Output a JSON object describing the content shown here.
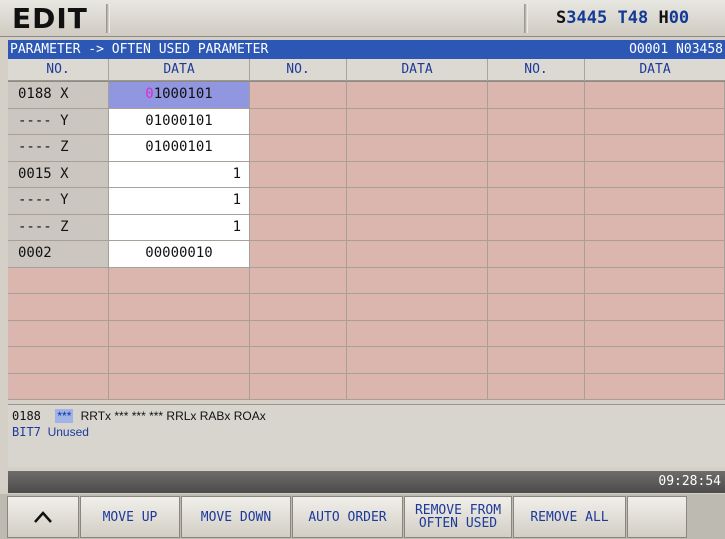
{
  "top": {
    "mode": "EDIT",
    "s_label": "S",
    "s_value": "3445",
    "t_label": "T",
    "t_value": "48",
    "h_label": "H",
    "h_value": "00"
  },
  "title": {
    "path": "PARAMETER -> OFTEN USED PARAMETER",
    "program": "O0001 N03458"
  },
  "table": {
    "headers": [
      "NO.",
      "DATA",
      "NO.",
      "DATA",
      "NO.",
      "DATA"
    ],
    "rows": [
      {
        "no": "0188 X",
        "data_cursor": "0",
        "data": "1000101"
      },
      {
        "no": "---- Y",
        "data": "01000101"
      },
      {
        "no": "---- Z",
        "data": "01000101"
      },
      {
        "no": "0015 X",
        "data": "1"
      },
      {
        "no": "---- Y",
        "data": "1"
      },
      {
        "no": "---- Z",
        "data": "1"
      },
      {
        "no": "0002",
        "data": "00000010"
      }
    ],
    "empty_rows": 5
  },
  "info": {
    "param": "0188",
    "bit_selected": "***",
    "bits": "RRTx *** *** *** RRLx RABx ROAx",
    "bit_label": "BIT7",
    "bit_desc": "Unused"
  },
  "status": {
    "time": "09:28:54"
  },
  "softkeys": {
    "back_icon": "caret-up-icon",
    "move_up": "MOVE UP",
    "move_down": "MOVE DOWN",
    "auto_order": "AUTO ORDER",
    "remove_from_line1": "REMOVE FROM",
    "remove_from_line2": "OFTEN USED",
    "remove_all": "REMOVE ALL"
  },
  "colors": {
    "title_bar": "#2c57b4",
    "status_text": "#123a96",
    "empty_cell": "#dbb6ae",
    "selected_cell": "#9096df",
    "cursor_digit": "#e02ad0"
  }
}
